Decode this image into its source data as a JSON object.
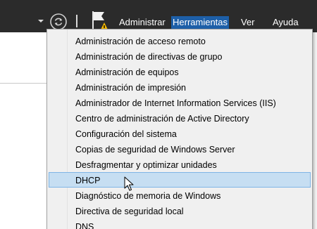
{
  "menubar": {
    "items": [
      {
        "label": "Administrar"
      },
      {
        "label": "Herramientas"
      },
      {
        "label": "Ver"
      },
      {
        "label": "Ayuda"
      }
    ],
    "active": "Herramientas",
    "accent": "#1d5fa8"
  },
  "toolbar": {
    "icons": [
      "chevron-down-icon",
      "refresh-icon",
      "flag-warning-icon"
    ]
  },
  "tools_menu": {
    "items": [
      {
        "label": "Administración de acceso remoto"
      },
      {
        "label": "Administración de directivas de grupo"
      },
      {
        "label": "Administración de equipos"
      },
      {
        "label": "Administración de impresión"
      },
      {
        "label": "Administrador de Internet Information Services (IIS)"
      },
      {
        "label": "Centro de administración de Active Directory"
      },
      {
        "label": "Configuración del sistema"
      },
      {
        "label": "Copias de seguridad de Windows Server"
      },
      {
        "label": "Desfragmentar y optimizar unidades"
      },
      {
        "label": "DHCP"
      },
      {
        "label": "Diagnóstico de memoria de Windows"
      },
      {
        "label": "Directiva de seguridad local"
      },
      {
        "label": "DNS"
      }
    ],
    "highlighted": "DHCP",
    "highlight_color": "#c6def2"
  }
}
